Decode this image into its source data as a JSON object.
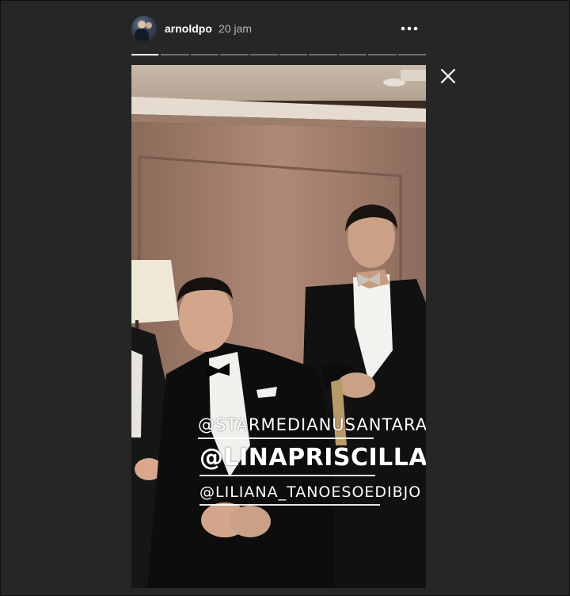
{
  "header": {
    "username": "arnoldpo",
    "time": "20 jam",
    "avatar_icon": "user-avatar",
    "more_icon": "more-horizontal-icon"
  },
  "progress": {
    "segments": 10,
    "current_index": 0,
    "current_progress": 0.95
  },
  "close_icon": "close-icon",
  "story": {
    "mentions": [
      "@STARMEDIANUSANTARA",
      "@LINAPRISCILLA",
      "@LILIANA_TANOESOEDIBJO"
    ]
  },
  "colors": {
    "background": "#262626",
    "text": "#ffffff",
    "muted": "#b5b5b5"
  }
}
